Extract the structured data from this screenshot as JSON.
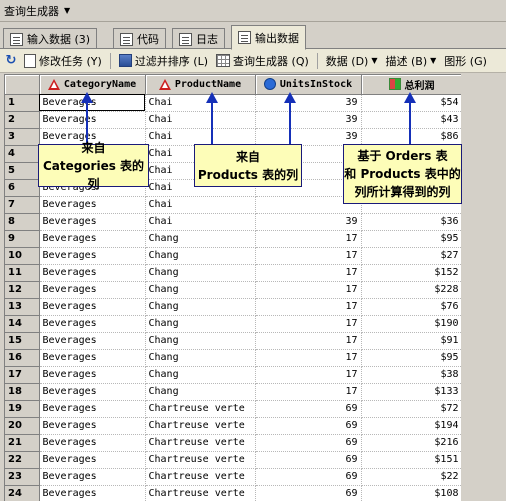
{
  "title": "查询生成器",
  "tabs": [
    {
      "label": "输入数据 (3)",
      "icon": "input-data-icon"
    },
    {
      "label": "代码",
      "icon": "code-icon"
    },
    {
      "label": "日志",
      "icon": "log-icon"
    },
    {
      "label": "输出数据",
      "icon": "output-data-icon",
      "active": true
    }
  ],
  "toolbar": {
    "modify_task": "修改任务 (Y)",
    "filter_sort": "过滤并排序 (L)",
    "query_builder": "查询生成器 (Q)",
    "data": "数据 (D)",
    "describe": "描述 (B)",
    "graph": "图形 (G)"
  },
  "columns": [
    {
      "name": "CategoryName",
      "icon": "text-column-icon"
    },
    {
      "name": "ProductName",
      "icon": "text-column-icon"
    },
    {
      "name": "UnitsInStock",
      "icon": "numeric-column-icon"
    },
    {
      "name": "总利润",
      "icon": "computed-column-icon"
    }
  ],
  "rows": [
    [
      "1",
      "Beverages",
      "Chai",
      "39",
      "$54"
    ],
    [
      "2",
      "Beverages",
      "Chai",
      "39",
      "$43"
    ],
    [
      "3",
      "Beverages",
      "Chai",
      "39",
      "$86"
    ],
    [
      "4",
      "Beverages",
      "Chai",
      "",
      ""
    ],
    [
      "5",
      "Beverages",
      "Chai",
      "",
      ""
    ],
    [
      "6",
      "Beverages",
      "Chai",
      "",
      ""
    ],
    [
      "7",
      "Beverages",
      "Chai",
      "",
      ""
    ],
    [
      "8",
      "Beverages",
      "Chai",
      "39",
      "$36"
    ],
    [
      "9",
      "Beverages",
      "Chang",
      "17",
      "$95"
    ],
    [
      "10",
      "Beverages",
      "Chang",
      "17",
      "$27"
    ],
    [
      "11",
      "Beverages",
      "Chang",
      "17",
      "$152"
    ],
    [
      "12",
      "Beverages",
      "Chang",
      "17",
      "$228"
    ],
    [
      "13",
      "Beverages",
      "Chang",
      "17",
      "$76"
    ],
    [
      "14",
      "Beverages",
      "Chang",
      "17",
      "$190"
    ],
    [
      "15",
      "Beverages",
      "Chang",
      "17",
      "$91"
    ],
    [
      "16",
      "Beverages",
      "Chang",
      "17",
      "$95"
    ],
    [
      "17",
      "Beverages",
      "Chang",
      "17",
      "$38"
    ],
    [
      "18",
      "Beverages",
      "Chang",
      "17",
      "$133"
    ],
    [
      "19",
      "Beverages",
      "Chartreuse verte",
      "69",
      "$72"
    ],
    [
      "20",
      "Beverages",
      "Chartreuse verte",
      "69",
      "$194"
    ],
    [
      "21",
      "Beverages",
      "Chartreuse verte",
      "69",
      "$216"
    ],
    [
      "22",
      "Beverages",
      "Chartreuse verte",
      "69",
      "$151"
    ],
    [
      "23",
      "Beverages",
      "Chartreuse verte",
      "69",
      "$22"
    ],
    [
      "24",
      "Beverages",
      "Chartreuse verte",
      "69",
      "$108"
    ]
  ],
  "callouts": {
    "categories": [
      "来自",
      "Categories 表的列"
    ],
    "products": [
      "来自",
      "Products 表的列"
    ],
    "computed": [
      "基于 Orders 表",
      "和 Products 表中的",
      "列所计算得到的列"
    ]
  },
  "colors": {
    "callout_bg": "#fdfdb8",
    "arrow": "#1530b8"
  }
}
